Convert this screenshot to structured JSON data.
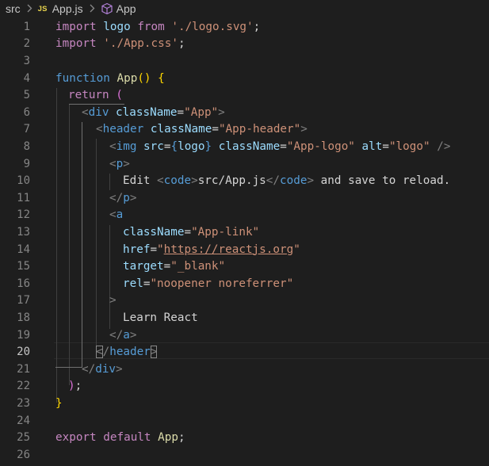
{
  "breadcrumb": {
    "folder": "src",
    "file_badge": "JS",
    "file": "App.js",
    "symbol": "App",
    "separator": ">"
  },
  "editor": {
    "active_line": 20,
    "line_numbers": [
      "1",
      "2",
      "3",
      "4",
      "5",
      "6",
      "7",
      "8",
      "9",
      "10",
      "11",
      "12",
      "13",
      "14",
      "15",
      "16",
      "17",
      "18",
      "19",
      "20",
      "21",
      "22",
      "23",
      "24",
      "25",
      "26"
    ],
    "code": {
      "l1_import": "import",
      "l1_logo": "logo",
      "l1_from": "from",
      "l1_path": "'./logo.svg'",
      "l1_semi": ";",
      "l2_import": "import",
      "l2_path": "'./App.css'",
      "l2_semi": ";",
      "l4_function": "function",
      "l4_name": "App",
      "l4_parens": "()",
      "l4_brace": "{",
      "l5_return": "return",
      "l5_paren": "(",
      "l6_lt": "<",
      "l6_tag": "div",
      "l6_attr": "className",
      "l6_eq": "=",
      "l6_val": "\"App\"",
      "l6_gt": ">",
      "l7_lt": "<",
      "l7_tag": "header",
      "l7_attr": "className",
      "l7_eq": "=",
      "l7_val": "\"App-header\"",
      "l7_gt": ">",
      "l8_lt": "<",
      "l8_tag": "img",
      "l8_attr1": "src",
      "l8_eq1": "=",
      "l8_ob": "{",
      "l8_var": "logo",
      "l8_cb": "}",
      "l8_attr2": "className",
      "l8_eq2": "=",
      "l8_val2": "\"App-logo\"",
      "l8_attr3": "alt",
      "l8_eq3": "=",
      "l8_val3": "\"logo\"",
      "l8_end": "/>",
      "l9_lt": "<",
      "l9_tag": "p",
      "l9_gt": ">",
      "l10_t1": "Edit ",
      "l10_lt1": "<",
      "l10_tag1": "code",
      "l10_gt1": ">",
      "l10_t2": "src/App.js",
      "l10_lt2": "</",
      "l10_tag2": "code",
      "l10_gt2": ">",
      "l10_t3": " and save to reload.",
      "l11_lt": "</",
      "l11_tag": "p",
      "l11_gt": ">",
      "l12_lt": "<",
      "l12_tag": "a",
      "l13_attr": "className",
      "l13_eq": "=",
      "l13_val": "\"App-link\"",
      "l14_attr": "href",
      "l14_eq": "=",
      "l14_q1": "\"",
      "l14_url": "https://reactjs.org",
      "l14_q2": "\"",
      "l15_attr": "target",
      "l15_eq": "=",
      "l15_val": "\"_blank\"",
      "l16_attr": "rel",
      "l16_eq": "=",
      "l16_val": "\"noopener noreferrer\"",
      "l17_gt": ">",
      "l18_text": "Learn React",
      "l19_lt": "</",
      "l19_tag": "a",
      "l19_gt": ">",
      "l20_lt": "<",
      "l20_slash": "/",
      "l20_tag": "header",
      "l20_gt": ">",
      "l21_lt": "</",
      "l21_tag": "div",
      "l21_gt": ">",
      "l22_paren": ")",
      "l22_semi": ";",
      "l23_brace": "}",
      "l25_export": "export",
      "l25_default": "default",
      "l25_name": "App",
      "l25_semi": ";"
    }
  },
  "colors": {
    "background": "#1e1e1e",
    "keyword_control": "#c586c0",
    "keyword": "#569cd6",
    "variable": "#9cdcfe",
    "string": "#ce9178",
    "function": "#dcdcaa",
    "punctuation": "#808080",
    "text": "#d4d4d4",
    "bracket_level1": "#ffd700",
    "bracket_level2": "#da70d6",
    "js_badge": "#e8d44d"
  }
}
